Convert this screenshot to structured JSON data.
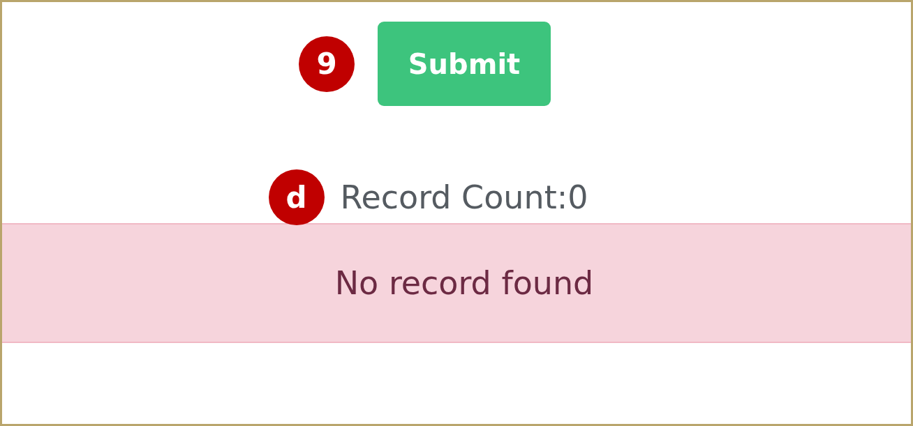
{
  "submit_button": {
    "label": "Submit",
    "marker": "9"
  },
  "record_count": {
    "text": "Record Count:0",
    "marker": "d"
  },
  "alert": {
    "text": "No record found"
  }
}
